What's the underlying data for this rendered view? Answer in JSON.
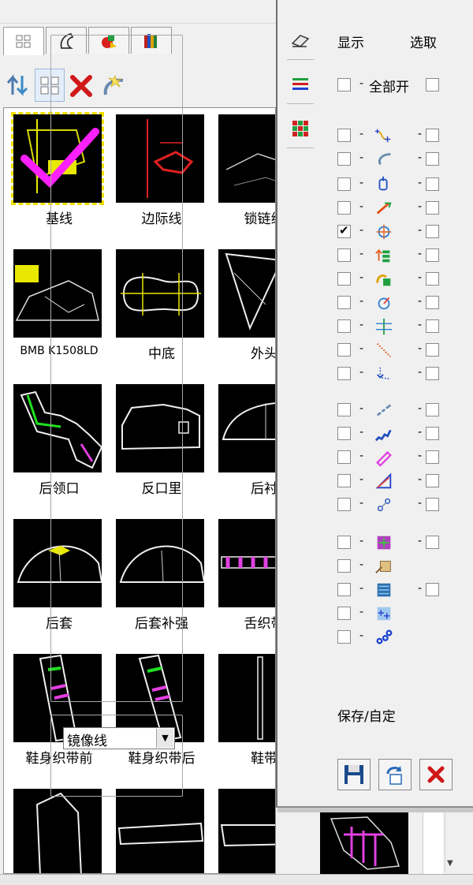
{
  "window": {
    "show_header": "显示",
    "select_header": "选取",
    "all_on": "全部开"
  },
  "tiles": [
    {
      "label": "基线",
      "kind": "baseline",
      "selected": true
    },
    {
      "label": "边际线",
      "kind": "margin"
    },
    {
      "label": "锁链线",
      "kind": "chain"
    },
    {
      "label": "BMB K1508LD",
      "kind": "bmb",
      "small": true
    },
    {
      "label": "中底",
      "kind": "insole"
    },
    {
      "label": "外头",
      "kind": "outer"
    },
    {
      "label": "后领口",
      "kind": "collar"
    },
    {
      "label": "反口里",
      "kind": "lining"
    },
    {
      "label": "后衬",
      "kind": "backlining"
    },
    {
      "label": "后套",
      "kind": "counter"
    },
    {
      "label": "后套补强",
      "kind": "counter2"
    },
    {
      "label": "舌织带",
      "kind": "tongue"
    },
    {
      "label": "鞋身织带前",
      "kind": "strap1"
    },
    {
      "label": "鞋身织带后",
      "kind": "strap2"
    },
    {
      "label": "鞋带",
      "kind": "lace"
    },
    {
      "label": "",
      "kind": "partA"
    },
    {
      "label": "",
      "kind": "partB"
    },
    {
      "label": "",
      "kind": "partC"
    }
  ],
  "layers": [
    {
      "icon": "add-point-icon",
      "show": false,
      "select": false
    },
    {
      "icon": "curve-icon",
      "show": false,
      "select": false
    },
    {
      "icon": "notch-icon",
      "show": false,
      "select": false
    },
    {
      "icon": "measure-line-icon",
      "show": false,
      "select": false
    },
    {
      "icon": "reference-icon",
      "show": true,
      "select": false
    },
    {
      "icon": "grading-icon",
      "show": false,
      "select": false
    },
    {
      "icon": "fill-icon",
      "show": false,
      "select": false
    },
    {
      "icon": "angle-icon",
      "show": false,
      "select": false
    },
    {
      "icon": "mirror-icon",
      "show": false,
      "select": false
    },
    {
      "icon": "seam-icon",
      "show": false,
      "select": false
    },
    {
      "icon": "arrow-line-icon",
      "show": false,
      "select": false
    },
    {
      "icon": "stitch-icon",
      "show": false,
      "select": false
    },
    {
      "icon": "zigzag-icon",
      "show": false,
      "select": false
    },
    {
      "icon": "tape-icon",
      "show": false,
      "select": false
    },
    {
      "icon": "triangle-icon",
      "show": false,
      "select": false
    },
    {
      "icon": "link-icon",
      "show": false,
      "select": false
    },
    {
      "icon": "grain-icon",
      "show": false,
      "select": false
    },
    {
      "icon": "tag-icon",
      "show": false,
      "has_select": false
    },
    {
      "icon": "texture-icon",
      "show": false,
      "select": false
    },
    {
      "icon": "plus-grid-icon",
      "show": false,
      "has_select": false
    },
    {
      "icon": "dots-icon",
      "show": false,
      "has_select": false
    }
  ],
  "save": {
    "title": "保存/自定",
    "preset": "镜像线"
  }
}
